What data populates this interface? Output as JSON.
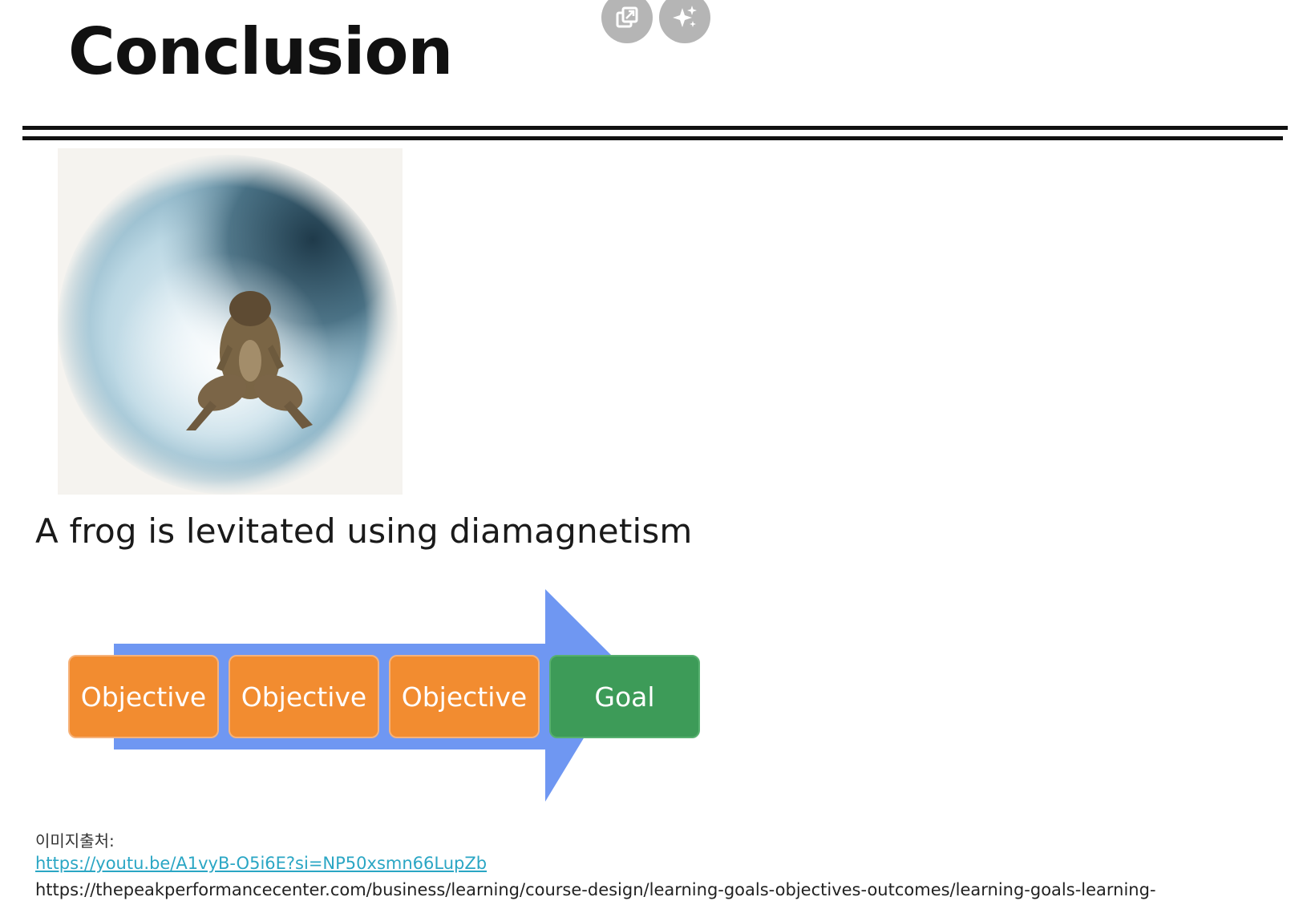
{
  "slide": {
    "title": "Conclusion",
    "caption": "A frog is levitated using diamagnetism"
  },
  "overlay_buttons": [
    {
      "icon": "open-external-icon"
    },
    {
      "icon": "sparkle-icon"
    }
  ],
  "photo": {
    "subject": "frog-levitation-photo"
  },
  "diagram": {
    "steps": [
      {
        "label": "Objective",
        "kind": "objective"
      },
      {
        "label": "Objective",
        "kind": "objective"
      },
      {
        "label": "Objective",
        "kind": "objective"
      },
      {
        "label": "Goal",
        "kind": "goal"
      }
    ],
    "colors": {
      "arrow": "#6f97f2",
      "objective": "#f28c30",
      "goal": "#3d9b58"
    }
  },
  "sources": {
    "label": "이미지출처:",
    "link": "https://youtu.be/A1vyB-O5i6E?si=NP50xsmn66LupZb",
    "text": "https://thepeakperformancecenter.com/business/learning/course-design/learning-goals-objectives-outcomes/learning-goals-learning-"
  }
}
